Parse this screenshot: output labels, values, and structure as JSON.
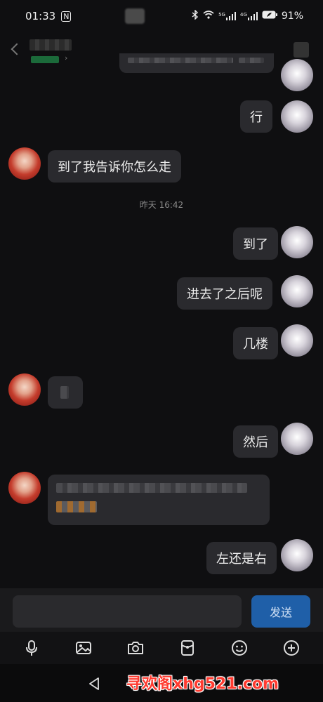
{
  "status_bar": {
    "time": "01:33",
    "nfc_glyph": "N",
    "battery": "91%",
    "network_5g": "5G",
    "network_4g": "4G"
  },
  "chat": {
    "messages": [
      {
        "side": "self",
        "text": "行"
      },
      {
        "side": "other",
        "text": "到了我告诉你怎么走"
      },
      {
        "side": "self",
        "text": "到了"
      },
      {
        "side": "self",
        "text": "进去了之后呢"
      },
      {
        "side": "self",
        "text": "几楼"
      },
      {
        "side": "self",
        "text": "然后"
      },
      {
        "side": "self",
        "text": "左还是右"
      }
    ],
    "timestamp": "昨天 16:42"
  },
  "input": {
    "send_label": "发送"
  },
  "toolbar": {
    "icons": [
      "microphone-icon",
      "image-icon",
      "camera-icon",
      "red-packet-icon",
      "emoji-icon",
      "plus-icon"
    ]
  },
  "watermark": "寻欢阁xhg521.com",
  "colors": {
    "background": "#0f0f11",
    "bubble": "#2a2a2e",
    "send_button": "#1f5fa8",
    "watermark": "#ff3b30"
  }
}
